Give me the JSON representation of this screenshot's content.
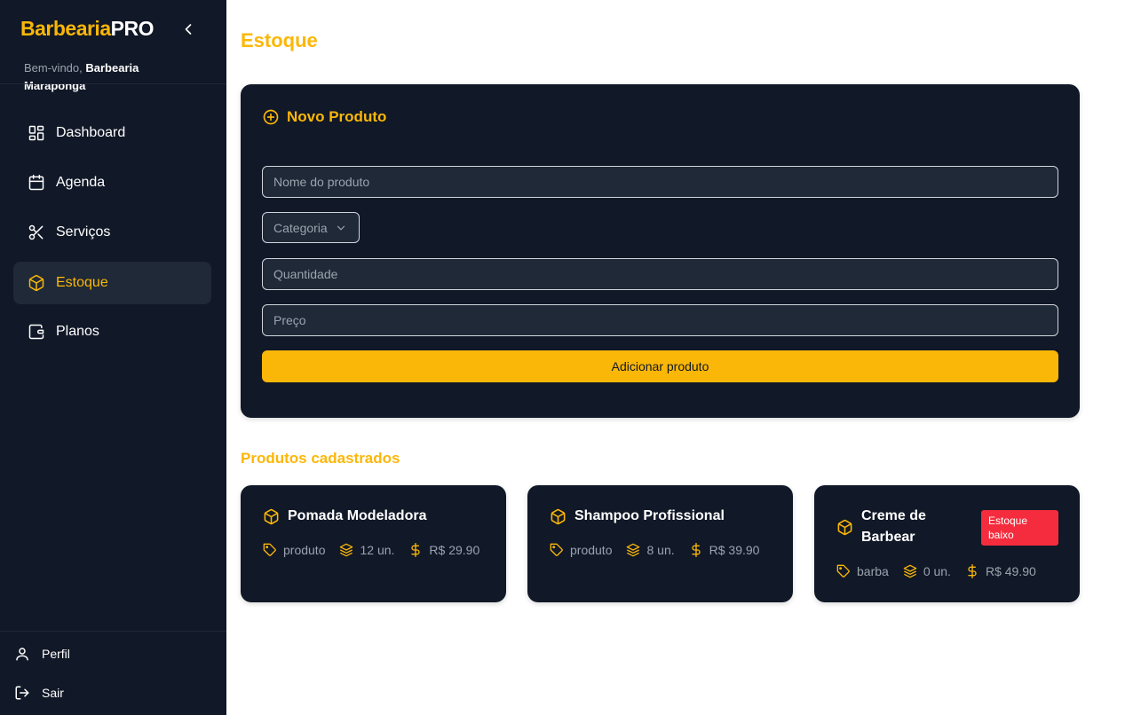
{
  "sidebar": {
    "brand_part1": "Barbearia",
    "brand_part2": "PRO",
    "welcome_prefix": "Bem-vindo, ",
    "welcome_name": "Barbearia Maraponga",
    "items": [
      {
        "label": "Dashboard",
        "icon": "dashboard-icon"
      },
      {
        "label": "Agenda",
        "icon": "calendar-icon"
      },
      {
        "label": "Serviços",
        "icon": "scissors-icon"
      },
      {
        "label": "Estoque",
        "icon": "box-icon",
        "active": true
      },
      {
        "label": "Planos",
        "icon": "wallet-icon"
      }
    ],
    "profile_label": "Perfil",
    "logout_label": "Sair"
  },
  "page": {
    "title": "Estoque"
  },
  "form": {
    "title": "Novo Produto",
    "name_placeholder": "Nome do produto",
    "category_label": "Categoria",
    "quantity_placeholder": "Quantidade",
    "price_placeholder": "Preço",
    "submit_label": "Adicionar produto"
  },
  "products": {
    "section_title": "Produtos cadastrados",
    "items": [
      {
        "name": "Pomada Modeladora",
        "category": "produto",
        "quantity": "12 un.",
        "price": "R$ 29.90"
      },
      {
        "name": "Shampoo Profissional",
        "category": "produto",
        "quantity": "8 un.",
        "price": "R$ 39.90"
      },
      {
        "name": "Creme de Barbear",
        "category": "barba",
        "quantity": "0 un.",
        "price": "R$ 49.90",
        "badge": "Estoque baixo"
      }
    ]
  },
  "colors": {
    "accent": "#fbb708",
    "sidebar_bg": "#111827",
    "card_bg": "#111827",
    "badge_red": "#f52c3d"
  }
}
